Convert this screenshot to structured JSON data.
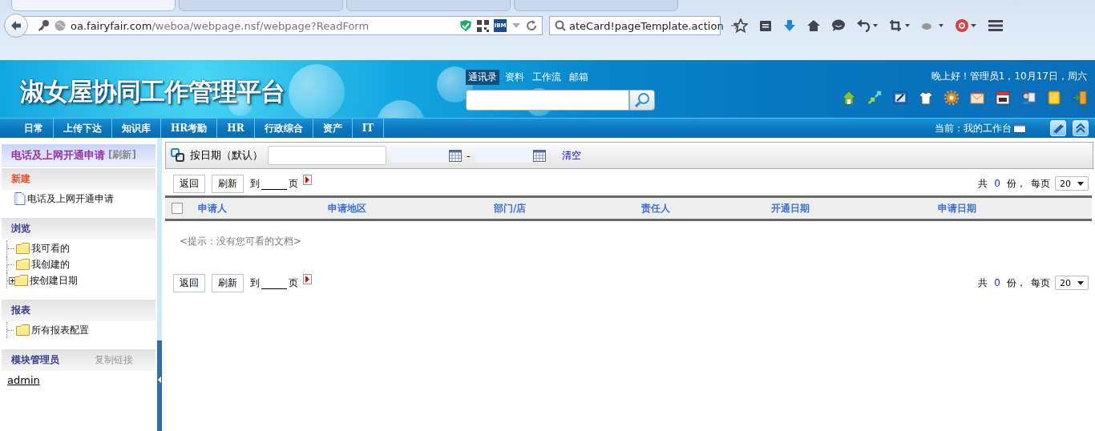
{
  "browser": {
    "tabs": [
      {
        "selected": true
      },
      {
        "selected": false
      },
      {
        "selected": false
      },
      {
        "selected": false
      }
    ],
    "url_host": "oa.fairyfair.com",
    "url_path": "/weboa/webpage.nsf/webpage?ReadForm",
    "extension_label": "IBM",
    "search_value": "ateCard!pageTemplate.action"
  },
  "header": {
    "title": "淑女屋协同工作管理平台",
    "top_links": [
      {
        "label": "通讯录",
        "selected": true
      },
      {
        "label": "资料",
        "selected": false
      },
      {
        "label": "工作流",
        "selected": false
      },
      {
        "label": "邮箱",
        "selected": false
      }
    ],
    "greeting": "晚上好！管理员1，10月17日，周六"
  },
  "nav": {
    "items": [
      "日常",
      "上传下达",
      "知识库",
      "HR考勤",
      "HR",
      "行政综合",
      "资产",
      "IT"
    ],
    "current_label": "当前：",
    "current_value": "我的工作台"
  },
  "sidebar": {
    "title": "电话及上网开通申请",
    "refresh": "[刷新]",
    "sections": [
      {
        "heading": "新建",
        "kind": "new",
        "items": [
          {
            "label": "电话及上网开通申请",
            "kind": "doc"
          }
        ]
      },
      {
        "heading": "浏览",
        "kind": "group",
        "items": [
          {
            "label": "我可看的",
            "kind": "folder",
            "expandable": false
          },
          {
            "label": "我创建的",
            "kind": "folder",
            "expandable": false
          },
          {
            "label": "按创建日期",
            "kind": "folder",
            "expandable": true
          }
        ]
      },
      {
        "heading": "报表",
        "kind": "group",
        "items": [
          {
            "label": "所有报表配置",
            "kind": "folder",
            "expandable": false
          }
        ]
      },
      {
        "heading": "模块管理员",
        "kind": "group",
        "action": "复制链接",
        "items": [
          {
            "label": "admin",
            "kind": "link"
          }
        ]
      }
    ]
  },
  "filter": {
    "label": "按日期（默认）",
    "separator": "-",
    "clear": "清空"
  },
  "pager_top": {
    "back": "返回",
    "refresh": "刷新",
    "goto_prefix": "到",
    "goto_suffix": "页",
    "total_prefix": "共",
    "total": "0",
    "total_suffix": "份，",
    "per_page_label": "每页",
    "per_page": "20"
  },
  "table": {
    "select_all": {
      "checked": false
    },
    "columns": [
      "申请人",
      "申请地区",
      "部门/店",
      "责任人",
      "开通日期",
      "申请日期"
    ],
    "empty_message": "<提示：没有您可看的文档>"
  },
  "pager_bottom": {
    "back": "返回",
    "refresh": "刷新",
    "goto_prefix": "到",
    "goto_suffix": "页",
    "total_prefix": "共",
    "total": "0",
    "total_suffix": "份，",
    "per_page_label": "每页",
    "per_page": "20"
  }
}
